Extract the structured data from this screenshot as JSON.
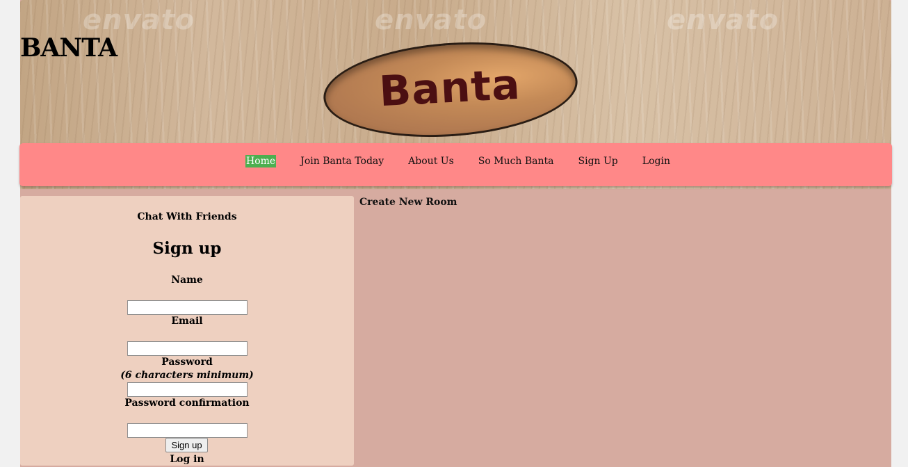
{
  "header": {
    "brand": "BANTA",
    "logo_text": "Banta",
    "watermarks": [
      "envato",
      "envato",
      "envato"
    ]
  },
  "nav": {
    "items": [
      {
        "label": "Home",
        "active": true
      },
      {
        "label": "Join Banta Today",
        "active": false
      },
      {
        "label": "About Us",
        "active": false
      },
      {
        "label": "So Much Banta",
        "active": false
      },
      {
        "label": "Sign Up",
        "active": false
      },
      {
        "label": "Login",
        "active": false
      }
    ],
    "active_color": "#4caf50",
    "bar_color": "#ff8888"
  },
  "sidebar": {
    "heading": "Chat With Friends",
    "form": {
      "title": "Sign up",
      "name_label": "Name",
      "name_value": "",
      "email_label": "Email",
      "email_value": "",
      "password_label": "Password",
      "password_hint": "(6 characters minimum)",
      "password_value": "",
      "confirm_label": "Password confirmation",
      "confirm_value": "",
      "submit_label": "Sign up",
      "login_link": "Log in"
    }
  },
  "main": {
    "heading": "Create New Room"
  },
  "colors": {
    "page_bg": "#d6aba0",
    "panel_bg": "#eed0c0"
  }
}
